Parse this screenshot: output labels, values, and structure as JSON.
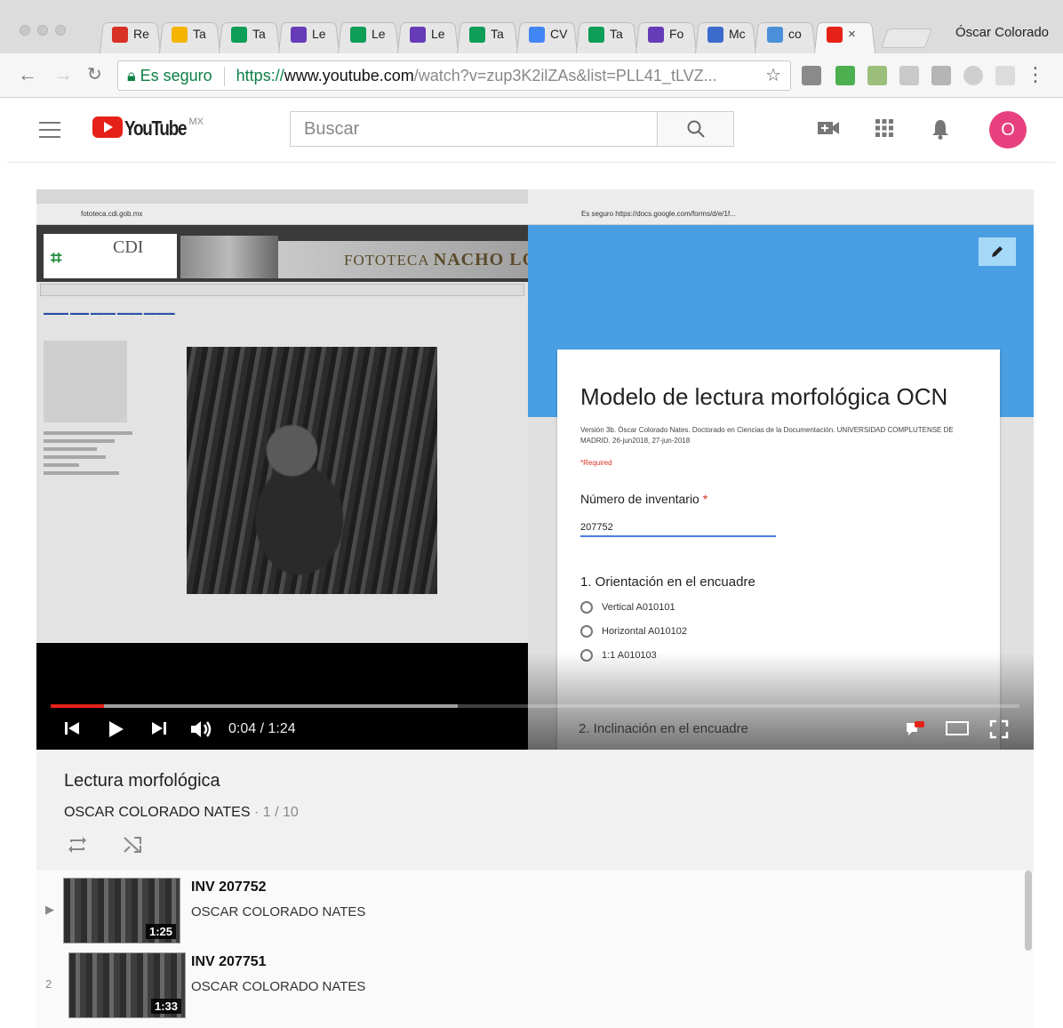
{
  "browser": {
    "profile_name": "Óscar Colorado",
    "tabs": [
      {
        "label": "Re",
        "icon": "gmail-icon",
        "color": "#d93025",
        "active": false
      },
      {
        "label": "Ta",
        "icon": "drive-icon",
        "color": "#f4b400",
        "active": false
      },
      {
        "label": "Ta",
        "icon": "sheets-icon",
        "color": "#0f9d58",
        "active": false
      },
      {
        "label": "Le",
        "icon": "forms-icon",
        "color": "#673ab7",
        "active": false
      },
      {
        "label": "Le",
        "icon": "sheets-icon",
        "color": "#0f9d58",
        "active": false
      },
      {
        "label": "Le",
        "icon": "forms-icon",
        "color": "#673ab7",
        "active": false
      },
      {
        "label": "Ta",
        "icon": "sheets-icon",
        "color": "#0f9d58",
        "active": false
      },
      {
        "label": "CV",
        "icon": "docs-icon",
        "color": "#4285f4",
        "active": false
      },
      {
        "label": "Ta",
        "icon": "sheets-icon",
        "color": "#0f9d58",
        "active": false
      },
      {
        "label": "Fo",
        "icon": "forms-icon",
        "color": "#673ab7",
        "active": false
      },
      {
        "label": "Mc",
        "icon": "pp-icon",
        "color": "#3b6bcc",
        "active": false
      },
      {
        "label": "co",
        "icon": "wr-icon",
        "color": "#4a90d9",
        "active": false
      },
      {
        "label": "×",
        "icon": "youtube-icon",
        "color": "#e62117",
        "active": true
      }
    ],
    "address": {
      "secure_label": "Es seguro",
      "scheme": "https://",
      "host": "www.youtube.com",
      "path": "/watch?v=zup3K2ilZAs&list=PLL41_tLVZ..."
    }
  },
  "youtube": {
    "region": "MX",
    "search_placeholder": "Buscar",
    "avatar_letter": "O",
    "colors": {
      "brand": "#e62117",
      "avatar": "#e8407e"
    }
  },
  "video": {
    "current_time": "0:04",
    "duration": "1:24",
    "time_display": "0:04 / 1:24",
    "played_fraction": 0.055,
    "buffered_fraction": 0.42,
    "left_frame": {
      "url": "fototeca.cdi.gob.mx",
      "logo_text": "CDI",
      "banner_text": "FOTOTECA",
      "banner_bold": "NACHO LÓ"
    },
    "form": {
      "url": "Es seguro  https://docs.google.com/forms/d/e/1f...",
      "title": "Modelo de lectura morfológica OCN",
      "description": "Versión 3b. Óscar Colorado Nates. Doctorado en Ciencias de la Documentación. UNIVERSIDAD COMPLUTENSE DE MADRID. 26-jun2018, 27-jun-2018",
      "required_note": "*Required",
      "field_label": "Número de inventario",
      "field_required_mark": "*",
      "field_value": "207752",
      "question_1": "1. Orientación en el encuadre",
      "options": [
        "Vertical A010101",
        "Horizontal A010102",
        "1:1 A010103"
      ],
      "question_2": "2. Inclinación en el encuadre"
    }
  },
  "playlist": {
    "title": "Lectura morfológica",
    "owner": "OSCAR COLORADO NATES",
    "position": " · 1 / 10",
    "items": [
      {
        "index": "▶",
        "title": "INV 207752",
        "owner": "OSCAR COLORADO NATES",
        "duration": "1:25"
      },
      {
        "index": "2",
        "title": "INV 207751",
        "owner": "OSCAR COLORADO NATES",
        "duration": "1:33"
      }
    ]
  }
}
